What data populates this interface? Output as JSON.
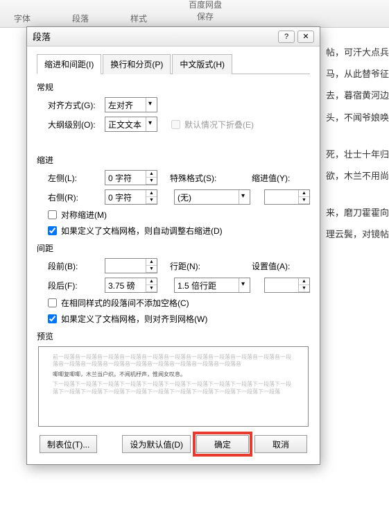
{
  "ribbon": {
    "group_font": "字体",
    "group_paragraph": "段落",
    "group_styles": "样式",
    "group_cloud_title": "百度网盘",
    "group_cloud_sub": "保存"
  },
  "background_lines": [
    "帖，可汗大点兵",
    "马，从此替爷征",
    "去，暮宿黄河边",
    "头，不闻爷娘唤",
    "死，壮士十年归",
    "欲，木兰不用尚",
    "来，磨刀霍霍向",
    "理云鬓，对镜帖"
  ],
  "dialog": {
    "title": "段落",
    "tabs": {
      "t1": "缩进和间距(I)",
      "t2": "换行和分页(P)",
      "t3": "中文版式(H)"
    },
    "general": {
      "label": "常规",
      "align_label": "对齐方式(G):",
      "align_value": "左对齐",
      "outline_label": "大纲级别(O):",
      "outline_value": "正文文本",
      "collapse_label": "默认情况下折叠(E)"
    },
    "indent": {
      "label": "缩进",
      "left_label": "左侧(L):",
      "left_value": "0 字符",
      "right_label": "右侧(R):",
      "right_value": "0 字符",
      "special_label": "特殊格式(S):",
      "special_value": "(无)",
      "by_label": "缩进值(Y):",
      "mirror_label": "对称缩进(M)",
      "autogrid_label": "如果定义了文档网格，则自动调整右缩进(D)"
    },
    "spacing": {
      "label": "间距",
      "before_label": "段前(B):",
      "before_value": "",
      "after_label": "段后(F):",
      "after_value": "3.75 磅",
      "line_label": "行距(N):",
      "line_value": "1.5 倍行距",
      "at_label": "设置值(A):",
      "at_value": "",
      "nosamestyle_label": "在相同样式的段落间不添加空格(C)",
      "snapgrid_label": "如果定义了文档网格，则对齐到网格(W)"
    },
    "preview": {
      "label": "预览",
      "grey1": "前一段落音一段落音一段落音一段落音一段落音一段落音一段落音一段落音一段落音一段落音一段落音一段落音一段落音一段落音一段落音一段落音一段落音一段落音一段落音",
      "dark": "唧唧复唧唧，木兰当户织。不闻机杼声，惟闻女叹息。",
      "grey2": "下一段落下一段落下一段落下一段落下一段落下一段落下一段落下一段落下一段落下一段落下一段落下一段落下一段落下一段落下一段落下一段落下一段落下一段落下一段落下一段落下一段落"
    },
    "buttons": {
      "tabs": "制表位(T)...",
      "default": "设为默认值(D)",
      "ok": "确定",
      "cancel": "取消"
    }
  }
}
